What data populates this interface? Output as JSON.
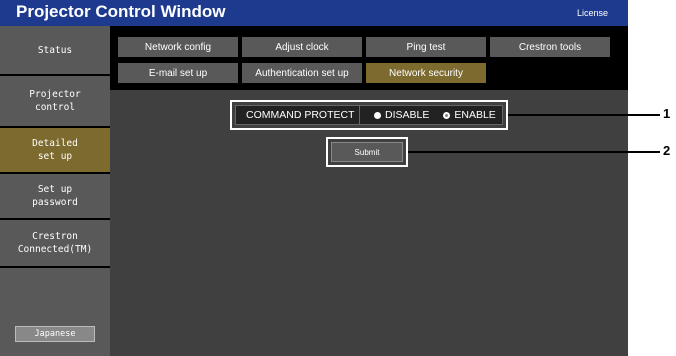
{
  "window": {
    "title": "Projector Control Window",
    "license": "License"
  },
  "sidebar": {
    "items": [
      {
        "label": "Status"
      },
      {
        "label": "Projector\ncontrol"
      },
      {
        "label": "Detailed\nset up"
      },
      {
        "label": "Set up\npassword"
      },
      {
        "label": "Crestron\nConnected(TM)"
      }
    ],
    "language_button": "Japanese",
    "active_item": "Detailed set up"
  },
  "tabs": {
    "row1": [
      "Network config",
      "Adjust clock",
      "Ping test",
      "Crestron tools"
    ],
    "row2": [
      "E-mail set up",
      "Authentication set up",
      "Network security"
    ],
    "active": "Network security"
  },
  "command_protect": {
    "label": "COMMAND PROTECT",
    "options": [
      "DISABLE",
      "ENABLE"
    ],
    "selected": "ENABLE"
  },
  "submit_label": "Submit",
  "callouts": [
    "1",
    "2"
  ],
  "colors": {
    "title_bar": "#1d3a8f",
    "active": "#7c6a2e",
    "sidebar": "#595959",
    "content": "#404040"
  }
}
